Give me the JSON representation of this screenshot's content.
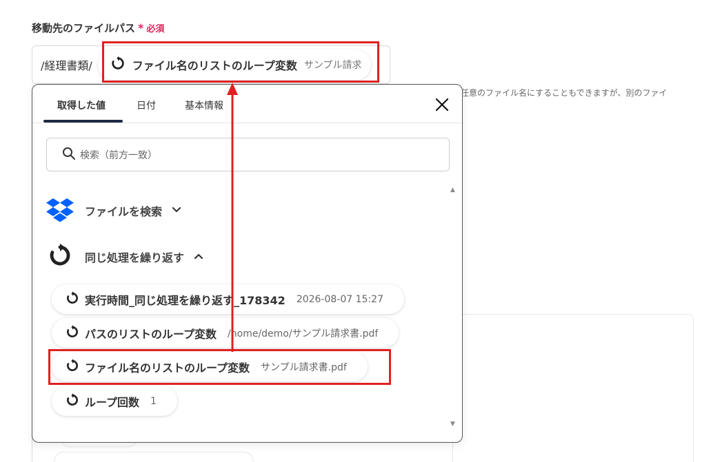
{
  "field": {
    "label": "移動先のファイルパス",
    "required_star": "*",
    "required_text": "必須"
  },
  "path_input": {
    "prefix": "/経理書類/",
    "chip_label": "ファイル名のリストのループ変数",
    "chip_value": "サンプル請求"
  },
  "help_text": "任意のファイル名にすることもできますが、別のファイ",
  "popup": {
    "tabs": [
      {
        "label": "取得した値",
        "active": true
      },
      {
        "label": "日付",
        "active": false
      },
      {
        "label": "基本情報",
        "active": false
      }
    ],
    "search_placeholder": "検索（前方一致）",
    "sections": [
      {
        "label": "ファイルを検索",
        "icon": "dropbox-icon",
        "expanded": false
      },
      {
        "label": "同じ処理を繰り返す",
        "icon": "loop-icon",
        "expanded": true
      }
    ],
    "items": [
      {
        "label": "実行時間_同じ処理を繰り返す_178342",
        "value": "2026-08-07 15:27"
      },
      {
        "label": "パスのリストのループ変数",
        "value": "/home/demo/サンプル請求書.pdf"
      },
      {
        "label": "ファイル名のリストのループ変数",
        "value": "サンプル請求書.pdf"
      },
      {
        "label": "ループ回数",
        "value": "1"
      }
    ]
  },
  "colors": {
    "highlight": "#e02020",
    "required": "#e0245e",
    "dropbox": "#0061fe",
    "tab_underline": "#1f2a44"
  }
}
